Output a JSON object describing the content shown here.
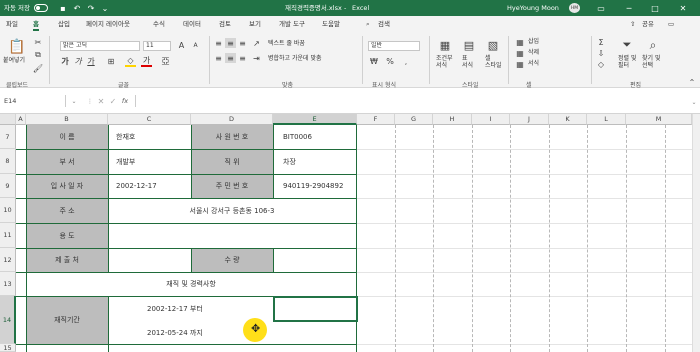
{
  "titlebar": {
    "autosave": "자동 저장",
    "autosave_state": "off",
    "filename": "재직경력증명서.xlsx",
    "app": "Excel",
    "search_label": "검색",
    "user_name": "HyeYoung Moon",
    "avatar_initials": "HM"
  },
  "tabs": [
    "파일",
    "홈",
    "삽입",
    "페이지 레이아웃",
    "수식",
    "데이터",
    "검토",
    "보기",
    "개발 도구",
    "도움말"
  ],
  "active_tab": "홈",
  "share_label": "공유",
  "ribbon": {
    "groups": [
      "클립보드",
      "글꼴",
      "맞춤",
      "표시 형식",
      "스타일",
      "셀",
      "편집"
    ],
    "paste_label": "붙여넣기",
    "font_name": "맑은 고딕",
    "font_size": "11",
    "wrap_text": "텍스트 줄 바꿈",
    "merge_center": "병합하고 가운데 맞춤",
    "number_format": "일반",
    "cond_format": "조건부\n서식",
    "table_format": "표\n서식",
    "cell_styles": "셀\n스타일",
    "insert": "삽입",
    "delete": "삭제",
    "format": "서식",
    "sort_filter": "정렬 및\n필터",
    "find_select": "찾기 및\n선택"
  },
  "formula": {
    "name_box": "E14",
    "fx": "fx",
    "value": ""
  },
  "columns": [
    "A",
    "B",
    "C",
    "D",
    "E",
    "F",
    "G",
    "H",
    "I",
    "J",
    "K",
    "L",
    "M"
  ],
  "selected_column": "E",
  "rows": [
    "7",
    "8",
    "9",
    "10",
    "11",
    "12",
    "13",
    "14",
    "15"
  ],
  "selected_row": "14",
  "cells": {
    "b7": "이       름",
    "c7": "한재호",
    "d7": "사  원  번  호",
    "e7": "BIT0006",
    "b8": "부       서",
    "c8": "개발부",
    "d8": "직        위",
    "e8": "차장",
    "b9": "입  사  일  자",
    "c9": "2002-12-17",
    "d9": "주  민  번  호",
    "e9": "940119-2904892",
    "b10": "주       소",
    "c10": "서울시 강서구 등촌동 106-3",
    "b11": "용       도",
    "b12": "제   출   처",
    "d12": "수        량",
    "title13": "재직 및 경력사항",
    "b14": "재직기간",
    "c14a": "2002-12-17 부터",
    "c14b": "2012-05-24 까지"
  },
  "accent": "#217346",
  "selected_cell": "E14"
}
